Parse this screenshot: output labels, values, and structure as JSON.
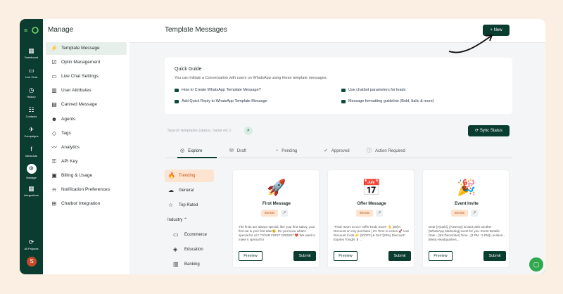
{
  "iconbar": {
    "logo": "≡",
    "items": [
      {
        "label": "Dashboard",
        "glyph": "▦"
      },
      {
        "label": "Live Chat",
        "glyph": "▭"
      },
      {
        "label": "History",
        "glyph": "◷"
      },
      {
        "label": "Contacts",
        "glyph": "☷"
      },
      {
        "label": "Campaigns",
        "glyph": "✈"
      },
      {
        "label": "Meta Ads",
        "glyph": "f"
      },
      {
        "label": "Manage",
        "glyph": "⚙"
      },
      {
        "label": "Integrations",
        "glyph": "▦"
      },
      {
        "label": "All Projects",
        "glyph": "⟳"
      }
    ],
    "avatar": "S"
  },
  "sidebar": {
    "title": "Manage",
    "items": [
      {
        "label": "Template Message",
        "glyph": "⚡"
      },
      {
        "label": "Optin Management",
        "glyph": "☑"
      },
      {
        "label": "Live Chat Settings",
        "glyph": "▭"
      },
      {
        "label": "User Attributes",
        "glyph": "▥"
      },
      {
        "label": "Canned Message",
        "glyph": "▤"
      },
      {
        "label": "Agents",
        "glyph": "☻"
      },
      {
        "label": "Tags",
        "glyph": "◇"
      },
      {
        "label": "Analytics",
        "glyph": "〰"
      },
      {
        "label": "API Key",
        "glyph": "⚿"
      },
      {
        "label": "Billing & Usage",
        "glyph": "▣"
      },
      {
        "label": "Notification Preferences",
        "glyph": "⍾"
      },
      {
        "label": "Chatbot Integration",
        "glyph": "⊞"
      }
    ]
  },
  "header": {
    "title": "Template Messages",
    "new_label": "+ New"
  },
  "quick_guide": {
    "title": "Quick Guide",
    "subtitle": "You can Initiate a Conversation with users on WhatsApp using these template messages.",
    "links": [
      "How to Create WhatsApp Template Message?",
      "Use chatbot parameters for leads",
      "Add Quick Reply to WhatsApp Template Message",
      "Message formatting guideline (Bold, Italic & more)"
    ]
  },
  "search": {
    "placeholder": "Search templates (status, name etc.)"
  },
  "sync_label": "⟳ Sync Status",
  "tabs": [
    {
      "label": "Explore",
      "glyph": "◎"
    },
    {
      "label": "Draft",
      "glyph": "✉"
    },
    {
      "label": "Pending",
      "glyph": "◔"
    },
    {
      "label": "Approved",
      "glyph": "✓"
    },
    {
      "label": "Action Required",
      "glyph": "ⓘ"
    }
  ],
  "categories": [
    {
      "label": "Trending",
      "glyph": "🔥"
    },
    {
      "label": "General",
      "glyph": "☁"
    },
    {
      "label": "Top Rated",
      "glyph": "☆"
    },
    {
      "label": "Industry ⌃",
      "glyph": ""
    },
    {
      "label": "Ecommerce",
      "glyph": "▭"
    },
    {
      "label": "Education",
      "glyph": "◈"
    },
    {
      "label": "Banking",
      "glyph": "▥"
    }
  ],
  "cards": [
    {
      "title": "First Message",
      "badge": "IMAGE",
      "illustration": "🚀",
      "body": "The firsts are always special, like your first salary, your first car & your first date😉. Do you know what's special for us? *YOUR FIRST ORDER* ❤️ We want to make it special for",
      "preview": "Preview",
      "submit": "Submit"
    },
    {
      "title": "Offer Message",
      "badge": "IMAGE",
      "illustration": "📅",
      "body": "*Final Hours to Go ! Offer Ends Soon* 👆 [25]% Discount on Any purchase | It's Time to Action 🚀 Use Discount Code 👉 [20OFF] & Get *[20%] Discount* Expires Tonight ⬇ ...",
      "preview": "Preview",
      "submit": "Submit"
    },
    {
      "title": "Event Invite",
      "badge": "IMAGE",
      "illustration": "🎉",
      "body": "Dear [Ayushi], [AiSensy] is back with another [WhatsApp Marketing] event for you. Event Details: Date - [3rd December] Time - [3 PM - 5 PM] Location - [Meta Headquarters,...",
      "preview": "Preview",
      "submit": "Submit"
    }
  ],
  "colors": {
    "brand": "#0a3c30",
    "accent": "#c4560f",
    "page_bg": "#fbeee3"
  }
}
